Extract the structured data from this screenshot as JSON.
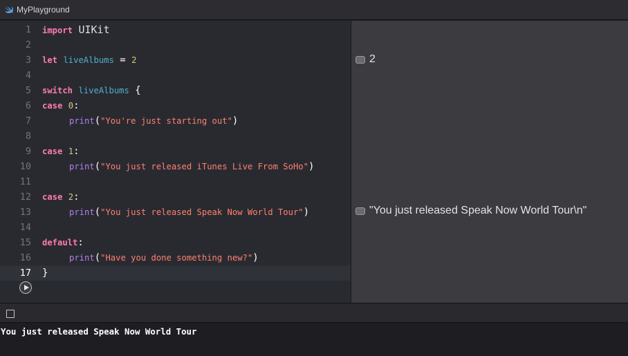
{
  "window": {
    "title": "MyPlayground"
  },
  "editor": {
    "lines": [
      {
        "n": "1",
        "parts": [
          [
            "kw",
            "import"
          ],
          [
            "pn",
            " "
          ],
          [
            "typ",
            "UIKit"
          ]
        ]
      },
      {
        "n": "2",
        "parts": []
      },
      {
        "n": "3",
        "parts": [
          [
            "kw",
            "let"
          ],
          [
            "pn",
            " "
          ],
          [
            "var",
            "liveAlbums"
          ],
          [
            "pn",
            " = "
          ],
          [
            "num",
            "2"
          ]
        ]
      },
      {
        "n": "4",
        "parts": []
      },
      {
        "n": "5",
        "parts": [
          [
            "kw",
            "switch"
          ],
          [
            "pn",
            " "
          ],
          [
            "var",
            "liveAlbums"
          ],
          [
            "pn",
            " {"
          ]
        ]
      },
      {
        "n": "6",
        "parts": [
          [
            "kw",
            "case"
          ],
          [
            "pn",
            " "
          ],
          [
            "num",
            "0"
          ],
          [
            "pn",
            ":"
          ]
        ]
      },
      {
        "n": "7",
        "indent": true,
        "parts": [
          [
            "fn",
            "print"
          ],
          [
            "pn",
            "("
          ],
          [
            "str",
            "\"You're just starting out\""
          ],
          [
            "pn",
            ")"
          ]
        ]
      },
      {
        "n": "8",
        "parts": []
      },
      {
        "n": "9",
        "parts": [
          [
            "kw",
            "case"
          ],
          [
            "pn",
            " "
          ],
          [
            "num",
            "1"
          ],
          [
            "pn",
            ":"
          ]
        ]
      },
      {
        "n": "10",
        "indent": true,
        "parts": [
          [
            "fn",
            "print"
          ],
          [
            "pn",
            "("
          ],
          [
            "str",
            "\"You just released iTunes Live From SoHo\""
          ],
          [
            "pn",
            ")"
          ]
        ]
      },
      {
        "n": "11",
        "parts": []
      },
      {
        "n": "12",
        "parts": [
          [
            "kw",
            "case"
          ],
          [
            "pn",
            " "
          ],
          [
            "num",
            "2"
          ],
          [
            "pn",
            ":"
          ]
        ]
      },
      {
        "n": "13",
        "indent": true,
        "parts": [
          [
            "fn",
            "print"
          ],
          [
            "pn",
            "("
          ],
          [
            "str",
            "\"You just released Speak Now World Tour\""
          ],
          [
            "pn",
            ")"
          ]
        ]
      },
      {
        "n": "14",
        "parts": []
      },
      {
        "n": "15",
        "parts": [
          [
            "kw",
            "default"
          ],
          [
            "pn",
            ":"
          ]
        ]
      },
      {
        "n": "16",
        "indent": true,
        "parts": [
          [
            "fn",
            "print"
          ],
          [
            "pn",
            "("
          ],
          [
            "str",
            "\"Have you done something new?\""
          ],
          [
            "pn",
            ")"
          ]
        ]
      },
      {
        "n": "17",
        "current": true,
        "parts": [
          [
            "pn",
            "}"
          ]
        ]
      }
    ]
  },
  "results": {
    "line3": "2",
    "line13": "\"You just released Speak Now World Tour\\n\""
  },
  "console": {
    "output": "You just released Speak Now World Tour"
  },
  "icons": {
    "app": "swift-icon",
    "run": "play-icon",
    "quicklook": "quicklook-icon"
  }
}
